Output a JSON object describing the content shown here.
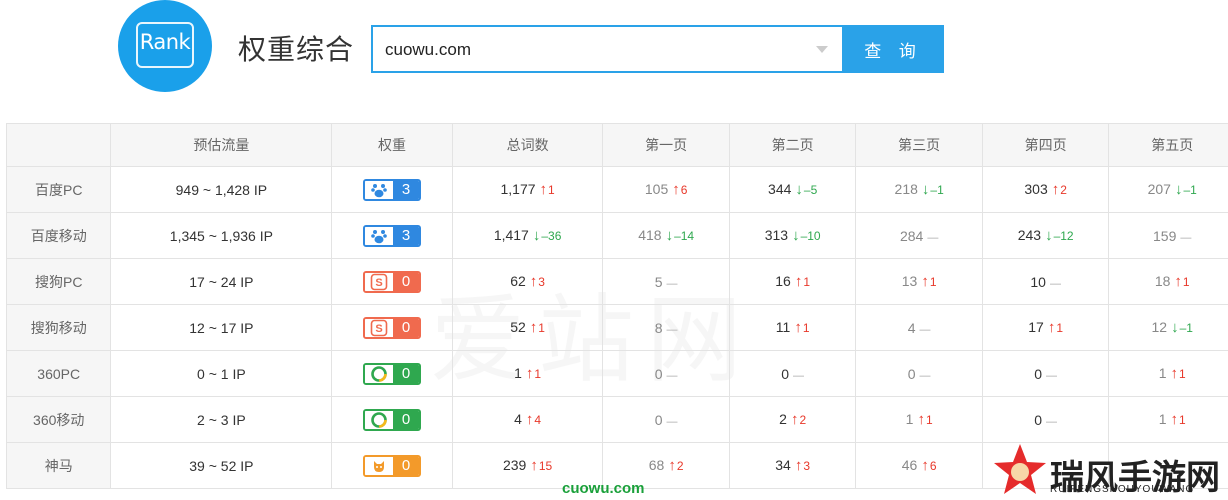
{
  "header": {
    "logo_text": "Rank",
    "title": "权重综合",
    "search_value": "cuowu.com",
    "search_button": "查 询"
  },
  "table": {
    "headers": [
      "",
      "预估流量",
      "权重",
      "总词数",
      "第一页",
      "第二页",
      "第三页",
      "第四页",
      "第五页"
    ],
    "rows": [
      {
        "engine": "百度PC",
        "flow": "949 ~ 1,428 IP",
        "badge": "baidu",
        "weight": "3",
        "cells": [
          {
            "v": "1,177",
            "t": "up",
            "d": "1"
          },
          {
            "v": "105",
            "t": "up",
            "d": "6",
            "muted": true
          },
          {
            "v": "344",
            "t": "down",
            "d": "–5"
          },
          {
            "v": "218",
            "t": "down",
            "d": "–1",
            "muted": true
          },
          {
            "v": "303",
            "t": "up",
            "d": "2"
          },
          {
            "v": "207",
            "t": "down",
            "d": "–1",
            "muted": true
          }
        ]
      },
      {
        "engine": "百度移动",
        "flow": "1,345 ~ 1,936 IP",
        "badge": "baidu",
        "weight": "3",
        "cells": [
          {
            "v": "1,417",
            "t": "down",
            "d": "–36"
          },
          {
            "v": "418",
            "t": "down",
            "d": "–14",
            "muted": true
          },
          {
            "v": "313",
            "t": "down",
            "d": "–10"
          },
          {
            "v": "284",
            "t": "flat",
            "d": "",
            "muted": true
          },
          {
            "v": "243",
            "t": "down",
            "d": "–12"
          },
          {
            "v": "159",
            "t": "flat",
            "d": "",
            "muted": true
          }
        ]
      },
      {
        "engine": "搜狗PC",
        "flow": "17 ~ 24 IP",
        "badge": "sogou",
        "weight": "0",
        "cells": [
          {
            "v": "62",
            "t": "up",
            "d": "3"
          },
          {
            "v": "5",
            "t": "flat",
            "d": "",
            "muted": true
          },
          {
            "v": "16",
            "t": "up",
            "d": "1"
          },
          {
            "v": "13",
            "t": "up",
            "d": "1",
            "muted": true
          },
          {
            "v": "10",
            "t": "flat",
            "d": ""
          },
          {
            "v": "18",
            "t": "up",
            "d": "1",
            "muted": true
          }
        ]
      },
      {
        "engine": "搜狗移动",
        "flow": "12 ~ 17 IP",
        "badge": "sogou",
        "weight": "0",
        "cells": [
          {
            "v": "52",
            "t": "up",
            "d": "1"
          },
          {
            "v": "8",
            "t": "flat",
            "d": "",
            "muted": true
          },
          {
            "v": "11",
            "t": "up",
            "d": "1"
          },
          {
            "v": "4",
            "t": "flat",
            "d": "",
            "muted": true
          },
          {
            "v": "17",
            "t": "up",
            "d": "1"
          },
          {
            "v": "12",
            "t": "down",
            "d": "–1",
            "muted": true
          }
        ]
      },
      {
        "engine": "360PC",
        "flow": "0 ~ 1 IP",
        "badge": "s360",
        "weight": "0",
        "cells": [
          {
            "v": "1",
            "t": "up",
            "d": "1"
          },
          {
            "v": "0",
            "t": "flat",
            "d": "",
            "muted": true
          },
          {
            "v": "0",
            "t": "flat",
            "d": ""
          },
          {
            "v": "0",
            "t": "flat",
            "d": "",
            "muted": true
          },
          {
            "v": "0",
            "t": "flat",
            "d": ""
          },
          {
            "v": "1",
            "t": "up",
            "d": "1",
            "muted": true
          }
        ]
      },
      {
        "engine": "360移动",
        "flow": "2 ~ 3 IP",
        "badge": "s360",
        "weight": "0",
        "cells": [
          {
            "v": "4",
            "t": "up",
            "d": "4"
          },
          {
            "v": "0",
            "t": "flat",
            "d": "",
            "muted": true
          },
          {
            "v": "2",
            "t": "up",
            "d": "2"
          },
          {
            "v": "1",
            "t": "up",
            "d": "1",
            "muted": true
          },
          {
            "v": "0",
            "t": "flat",
            "d": ""
          },
          {
            "v": "1",
            "t": "up",
            "d": "1",
            "muted": true
          }
        ]
      },
      {
        "engine": "神马",
        "flow": "39 ~ 52 IP",
        "badge": "sm",
        "weight": "0",
        "cells": [
          {
            "v": "239",
            "t": "up",
            "d": "15"
          },
          {
            "v": "68",
            "t": "up",
            "d": "2",
            "muted": true
          },
          {
            "v": "34",
            "t": "up",
            "d": "3"
          },
          {
            "v": "46",
            "t": "up",
            "d": "6",
            "muted": true
          },
          {
            "v": "",
            "t": "none",
            "d": ""
          },
          {
            "v": "",
            "t": "none",
            "d": ""
          }
        ]
      }
    ]
  },
  "watermarks": {
    "center": "爱站网",
    "url": "cuowu.com",
    "brand": "瑞风手游网",
    "brand_sub": "RUIFENGSHOUYOUWANG"
  },
  "colors": {
    "accent": "#2aa2e8",
    "up": "#e8382a",
    "down": "#2fa84f",
    "baidu": "#2f88e0",
    "sogou": "#f06a4e",
    "s360": "#2fa84f",
    "shenma": "#f39a2a"
  }
}
